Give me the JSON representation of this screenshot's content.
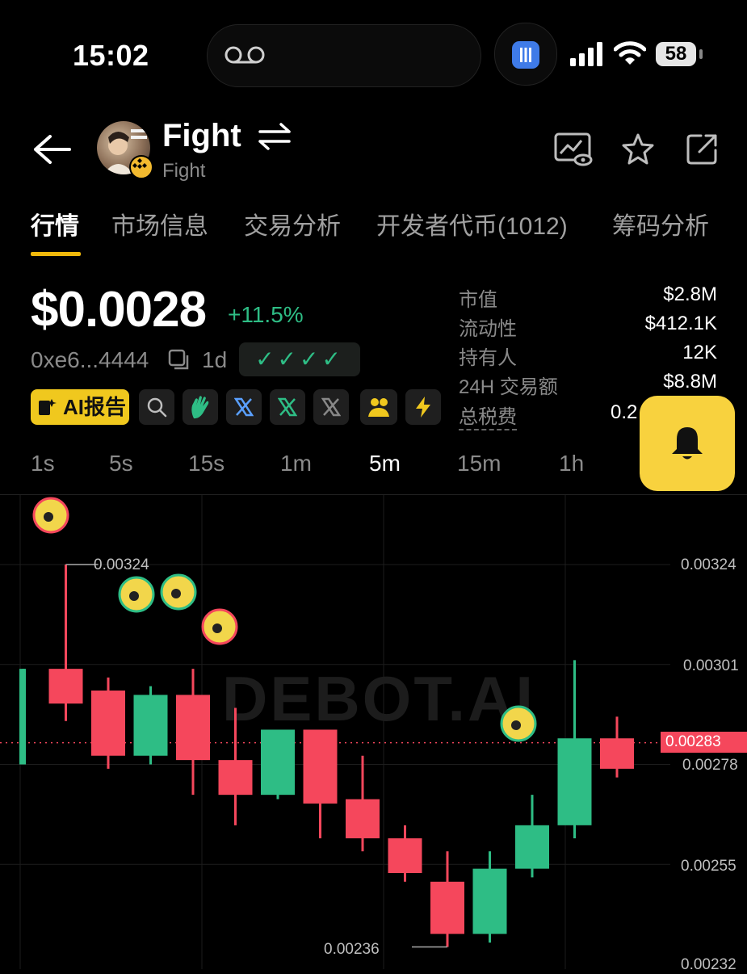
{
  "status_bar": {
    "time": "15:02",
    "battery": "58"
  },
  "token": {
    "name": "Fight",
    "subtitle": "Fight"
  },
  "tabs": [
    {
      "label": "行情"
    },
    {
      "label": "市场信息"
    },
    {
      "label": "交易分析"
    },
    {
      "label": "开发者代币(1012)"
    },
    {
      "label": "筹码分析"
    }
  ],
  "price": {
    "value": "$0.0028",
    "change": "+11.5%",
    "address": "0xe6...4444",
    "age": "1d",
    "checks": "✓✓✓✓"
  },
  "stats": [
    {
      "label": "市值",
      "value": "$2.8M"
    },
    {
      "label": "流动性",
      "value": "$412.1K"
    },
    {
      "label": "持有人",
      "value": "12K"
    },
    {
      "label": "24H 交易额",
      "value": "$8.8M"
    },
    {
      "label": "总税费",
      "value": "0.2"
    }
  ],
  "ai_report": {
    "label": "AI报告"
  },
  "intervals": [
    "1s",
    "5s",
    "15s",
    "1m",
    "5m",
    "15m",
    "1h"
  ],
  "active_interval": "5m",
  "colors": {
    "up": "#2ebd85",
    "down": "#f5475c",
    "accent": "#f0b90b",
    "bell": "#f8d23e"
  },
  "chart_data": {
    "type": "candlestick",
    "watermark": "DEBOT.AI",
    "y_ticks": [
      "0.00324",
      "0.00301",
      "0.00278",
      "0.00255",
      "0.00232"
    ],
    "current_price_label": "0.00283",
    "current_price": 0.00283,
    "high_label": "0.00324",
    "low_label": "0.00236",
    "ylim": [
      0.00232,
      0.00324
    ],
    "candles": [
      {
        "open": 0.00278,
        "close": 0.003,
        "high": 0.003,
        "low": 0.00278
      },
      {
        "open": 0.003,
        "close": 0.00292,
        "high": 0.00324,
        "low": 0.00288
      },
      {
        "open": 0.00295,
        "close": 0.0028,
        "high": 0.00298,
        "low": 0.00277
      },
      {
        "open": 0.0028,
        "close": 0.00294,
        "high": 0.00296,
        "low": 0.00278
      },
      {
        "open": 0.00294,
        "close": 0.00279,
        "high": 0.003,
        "low": 0.00271
      },
      {
        "open": 0.00279,
        "close": 0.00271,
        "high": 0.00291,
        "low": 0.00264
      },
      {
        "open": 0.00271,
        "close": 0.00286,
        "high": 0.00286,
        "low": 0.0027
      },
      {
        "open": 0.00286,
        "close": 0.00269,
        "high": 0.00286,
        "low": 0.00261
      },
      {
        "open": 0.0027,
        "close": 0.00261,
        "high": 0.0028,
        "low": 0.00258
      },
      {
        "open": 0.00261,
        "close": 0.00253,
        "high": 0.00264,
        "low": 0.00251
      },
      {
        "open": 0.00251,
        "close": 0.00239,
        "high": 0.00258,
        "low": 0.00236
      },
      {
        "open": 0.00239,
        "close": 0.00254,
        "high": 0.00258,
        "low": 0.00237
      },
      {
        "open": 0.00254,
        "close": 0.00264,
        "high": 0.00271,
        "low": 0.00252
      },
      {
        "open": 0.00264,
        "close": 0.00284,
        "high": 0.00302,
        "low": 0.00261
      },
      {
        "open": 0.00284,
        "close": 0.00277,
        "high": 0.00289,
        "low": 0.00275
      }
    ],
    "markers": [
      {
        "candle": 0,
        "kind": "sell"
      },
      {
        "candle": 2,
        "kind": "buy"
      },
      {
        "candle": 3,
        "kind": "buy"
      },
      {
        "candle": 4,
        "kind": "sell"
      },
      {
        "candle": 11,
        "kind": "buy"
      }
    ]
  }
}
